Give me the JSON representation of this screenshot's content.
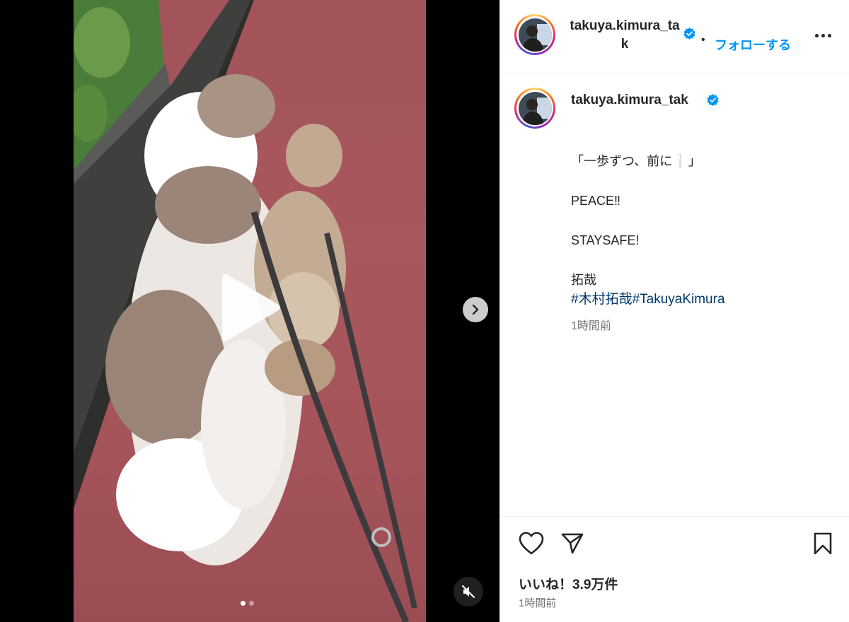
{
  "header": {
    "username": "takuya.kimura_tak",
    "separator": "•",
    "follow_label": "フォローする",
    "more_icon": "more-horizontal-icon"
  },
  "caption": {
    "username": "takuya.kimura_tak",
    "line1": "「一歩ずつ、前に❕」",
    "line2": "PEACE‼︎",
    "line3": "STAYSAFE!",
    "line4": "拓哉",
    "hashtags": "#木村拓哉#TakuyaKimura",
    "time": "1時間前"
  },
  "actions": {
    "likes": "いいね！3.9万件",
    "time": "1時間前",
    "like_icon": "heart-icon",
    "share_icon": "paper-plane-icon",
    "save_icon": "bookmark-icon"
  },
  "media": {
    "play_icon": "play-icon",
    "next_icon": "chevron-right-icon",
    "mute_icon": "speaker-muted-icon",
    "carousel_count": 2,
    "carousel_active": 1
  },
  "colors": {
    "follow": "#0095f6",
    "hashtag": "#00376b",
    "verified": "#0095f6",
    "muted_text": "#737373"
  }
}
